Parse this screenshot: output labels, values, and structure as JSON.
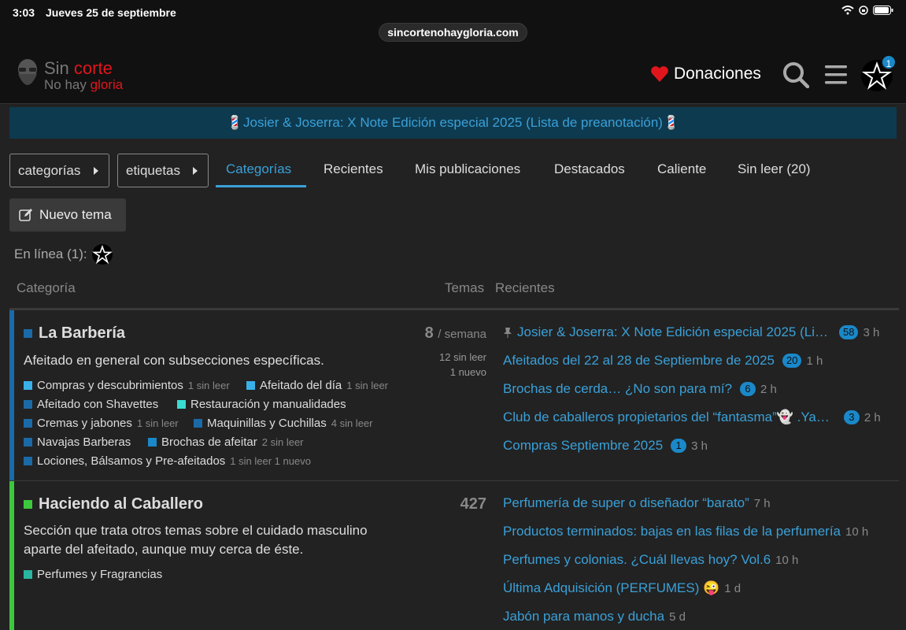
{
  "status": {
    "time": "3:03",
    "date": "Jueves 25 de septiembre",
    "url": "sincortenohaygloria.com"
  },
  "header": {
    "logo_sin": "Sin",
    "logo_corte": "corte",
    "logo_nohay": "No hay",
    "logo_gloria": "gloria",
    "donaciones": "Donaciones",
    "notifications": "1"
  },
  "banner": {
    "text": "💈Josier & Joserra: X Note Edición especial 2025 (Lista de preanotación)💈"
  },
  "nav": {
    "categorias_dd": "categorías",
    "etiquetas_dd": "etiquetas",
    "tabs": [
      "Categorías",
      "Recientes",
      "Mis publicaciones",
      "Destacados",
      "Caliente",
      "Sin leer (20)"
    ]
  },
  "new_topic": "Nuevo tema",
  "online": "En línea (1):",
  "table_header": {
    "category": "Categoría",
    "topics": "Temas",
    "latest": "Recientes"
  },
  "categories": [
    {
      "color": "#1a6aa8",
      "title": "La Barbería",
      "description": "Afeitado en general con subsecciones específicas.",
      "topics": "8",
      "topics_period": "/ semana",
      "unread": "12 sin leer",
      "new": "1 nuevo",
      "subcategories": [
        {
          "name": "Compras y descubrimientos",
          "count": "1 sin leer",
          "color": "#3ab0e8"
        },
        {
          "name": "Afeitado del día",
          "count": "1 sin leer",
          "color": "#3ab0e8"
        },
        {
          "name": "Afeitado con Shavettes",
          "count": "",
          "color": "#1a6aa8"
        },
        {
          "name": "Restauración y manualidades",
          "count": "",
          "color": "#3adbd0"
        },
        {
          "name": "Cremas y jabones",
          "count": "1 sin leer",
          "color": "#1a6aa8"
        },
        {
          "name": "Maquinillas y Cuchillas",
          "count": "4 sin leer",
          "color": "#1a6aa8"
        },
        {
          "name": "Navajas Barberas",
          "count": "",
          "color": "#1a6aa8"
        },
        {
          "name": "Brochas de afeitar",
          "count": "2 sin leer",
          "color": "#1a88c9"
        },
        {
          "name": "Lociones, Bálsamos y Pre-afeitados",
          "count": "1 sin leer  1 nuevo",
          "color": "#1a6aa8"
        }
      ],
      "latest": [
        {
          "title": "Josier & Joserra: X Note Edición especial 2025 (Li…",
          "badge": "58",
          "ago": "3 h",
          "pinned": true
        },
        {
          "title": "Afeitados del 22 al 28 de Septiembre de 2025",
          "badge": "20",
          "ago": "1 h"
        },
        {
          "title": "Brochas de cerda… ¿No son para mí?",
          "badge": "6",
          "ago": "2 h"
        },
        {
          "title": "Club de caballeros propietarios del “fantasma”👻 .Ya…",
          "badge": "3",
          "ago": "2 h"
        },
        {
          "title": "Compras Septiembre 2025",
          "badge": "1",
          "ago": "3 h"
        }
      ]
    },
    {
      "color": "#3cc83c",
      "title": "Haciendo al Caballero",
      "description": "Sección que trata otros temas sobre el cuidado masculino aparte del afeitado, aunque muy cerca de éste.",
      "topics": "427",
      "subcategories": [
        {
          "name": "Perfumes y Fragrancias",
          "count": "",
          "color": "#2ab5a0"
        }
      ],
      "latest": [
        {
          "title": "Perfumería de super o diseñador “barato”",
          "ago": "7 h"
        },
        {
          "title": "Productos terminados: bajas en las filas de la perfumería",
          "ago": "10 h"
        },
        {
          "title": "Perfumes y colonias. ¿Cuál llevas hoy? Vol.6",
          "ago": "10 h"
        },
        {
          "title": "Última Adquisición (PERFUMES) 😜",
          "ago": "1 d"
        },
        {
          "title": "Jabón para manos y ducha",
          "ago": "5 d"
        }
      ]
    }
  ]
}
